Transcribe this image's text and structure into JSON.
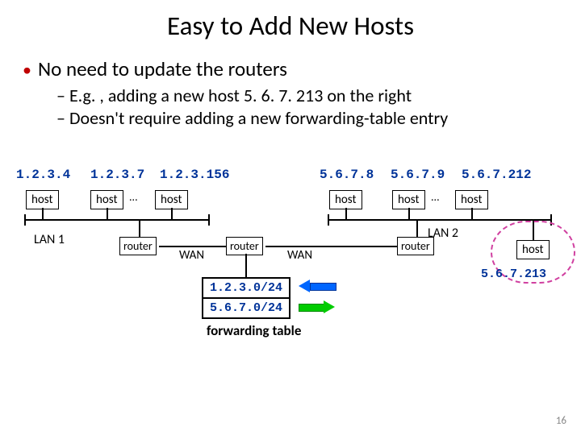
{
  "title": "Easy to Add New Hosts",
  "bullet_main": "No need to update the routers",
  "bullet_sub1": "E.g. , adding a new host 5. 6. 7. 213 on the right",
  "bullet_sub2": "Doesn't require adding a new forwarding-table entry",
  "lan1": {
    "ips": [
      "1.2.3.4",
      "1.2.3.7",
      "1.2.3.156"
    ],
    "host_label": "host",
    "dots": "...",
    "label": "LAN 1"
  },
  "lan2": {
    "ips": [
      "5.6.7.8",
      "5.6.7.9",
      "5.6.7.212"
    ],
    "host_label": "host",
    "dots": "...",
    "label": "LAN 2"
  },
  "new_host": {
    "label": "host",
    "ip": "5.6.7.213"
  },
  "router_label": "router",
  "wan_label": "WAN",
  "table": {
    "rows": [
      "1.2.3.0/24",
      "5.6.7.0/24"
    ],
    "caption": "forwarding table"
  },
  "slide_number": "16"
}
